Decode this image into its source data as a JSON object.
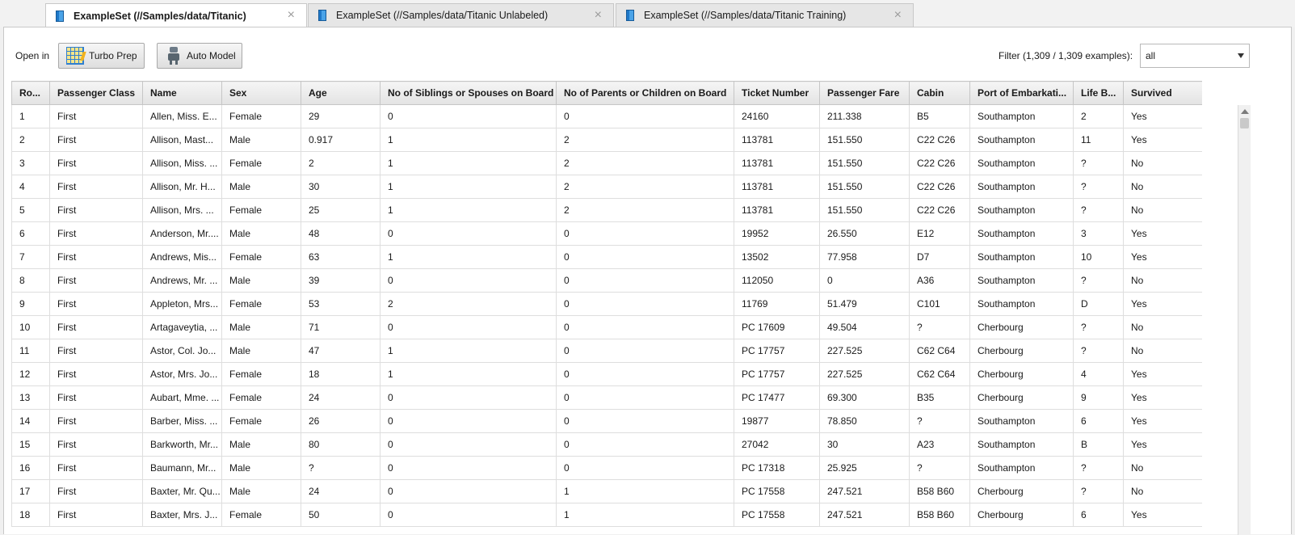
{
  "tabs": [
    {
      "label": "ExampleSet (//Samples/data/Titanic)",
      "active": true
    },
    {
      "label": "ExampleSet (//Samples/data/Titanic Unlabeled)",
      "active": false
    },
    {
      "label": "ExampleSet (//Samples/data/Titanic Training)",
      "active": false
    }
  ],
  "toolbar": {
    "open_in_label": "Open in",
    "turbo_prep_label": "Turbo Prep",
    "auto_model_label": "Auto Model",
    "filter_label": "Filter (1,309 / 1,309 examples):",
    "filter_value": "all"
  },
  "table": {
    "columns": [
      "Ro...",
      "Passenger Class",
      "Name",
      "Sex",
      "Age",
      "No of Siblings or Spouses on Board",
      "No of Parents or Children on Board",
      "Ticket Number",
      "Passenger Fare",
      "Cabin",
      "Port of Embarkati...",
      "Life B...",
      "Survived"
    ],
    "rows": [
      [
        "1",
        "First",
        "Allen, Miss. E...",
        "Female",
        "29",
        "0",
        "0",
        "24160",
        "211.338",
        "B5",
        "Southampton",
        "2",
        "Yes"
      ],
      [
        "2",
        "First",
        "Allison, Mast...",
        "Male",
        "0.917",
        "1",
        "2",
        "113781",
        "151.550",
        "C22 C26",
        "Southampton",
        "11",
        "Yes"
      ],
      [
        "3",
        "First",
        "Allison, Miss. ...",
        "Female",
        "2",
        "1",
        "2",
        "113781",
        "151.550",
        "C22 C26",
        "Southampton",
        "?",
        "No"
      ],
      [
        "4",
        "First",
        "Allison, Mr. H...",
        "Male",
        "30",
        "1",
        "2",
        "113781",
        "151.550",
        "C22 C26",
        "Southampton",
        "?",
        "No"
      ],
      [
        "5",
        "First",
        "Allison, Mrs. ...",
        "Female",
        "25",
        "1",
        "2",
        "113781",
        "151.550",
        "C22 C26",
        "Southampton",
        "?",
        "No"
      ],
      [
        "6",
        "First",
        "Anderson, Mr....",
        "Male",
        "48",
        "0",
        "0",
        "19952",
        "26.550",
        "E12",
        "Southampton",
        "3",
        "Yes"
      ],
      [
        "7",
        "First",
        "Andrews, Mis...",
        "Female",
        "63",
        "1",
        "0",
        "13502",
        "77.958",
        "D7",
        "Southampton",
        "10",
        "Yes"
      ],
      [
        "8",
        "First",
        "Andrews, Mr. ...",
        "Male",
        "39",
        "0",
        "0",
        "112050",
        "0",
        "A36",
        "Southampton",
        "?",
        "No"
      ],
      [
        "9",
        "First",
        "Appleton, Mrs...",
        "Female",
        "53",
        "2",
        "0",
        "11769",
        "51.479",
        "C101",
        "Southampton",
        "D",
        "Yes"
      ],
      [
        "10",
        "First",
        "Artagaveytia, ...",
        "Male",
        "71",
        "0",
        "0",
        "PC 17609",
        "49.504",
        "?",
        "Cherbourg",
        "?",
        "No"
      ],
      [
        "11",
        "First",
        "Astor, Col. Jo...",
        "Male",
        "47",
        "1",
        "0",
        "PC 17757",
        "227.525",
        "C62 C64",
        "Cherbourg",
        "?",
        "No"
      ],
      [
        "12",
        "First",
        "Astor, Mrs. Jo...",
        "Female",
        "18",
        "1",
        "0",
        "PC 17757",
        "227.525",
        "C62 C64",
        "Cherbourg",
        "4",
        "Yes"
      ],
      [
        "13",
        "First",
        "Aubart, Mme. ...",
        "Female",
        "24",
        "0",
        "0",
        "PC 17477",
        "69.300",
        "B35",
        "Cherbourg",
        "9",
        "Yes"
      ],
      [
        "14",
        "First",
        "Barber, Miss. ...",
        "Female",
        "26",
        "0",
        "0",
        "19877",
        "78.850",
        "?",
        "Southampton",
        "6",
        "Yes"
      ],
      [
        "15",
        "First",
        "Barkworth, Mr...",
        "Male",
        "80",
        "0",
        "0",
        "27042",
        "30",
        "A23",
        "Southampton",
        "B",
        "Yes"
      ],
      [
        "16",
        "First",
        "Baumann, Mr...",
        "Male",
        "?",
        "0",
        "0",
        "PC 17318",
        "25.925",
        "?",
        "Southampton",
        "?",
        "No"
      ],
      [
        "17",
        "First",
        "Baxter, Mr. Qu...",
        "Male",
        "24",
        "0",
        "1",
        "PC 17558",
        "247.521",
        "B58 B60",
        "Cherbourg",
        "?",
        "No"
      ],
      [
        "18",
        "First",
        "Baxter, Mrs. J...",
        "Female",
        "50",
        "0",
        "1",
        "PC 17558",
        "247.521",
        "B58 B60",
        "Cherbourg",
        "6",
        "Yes"
      ]
    ]
  }
}
